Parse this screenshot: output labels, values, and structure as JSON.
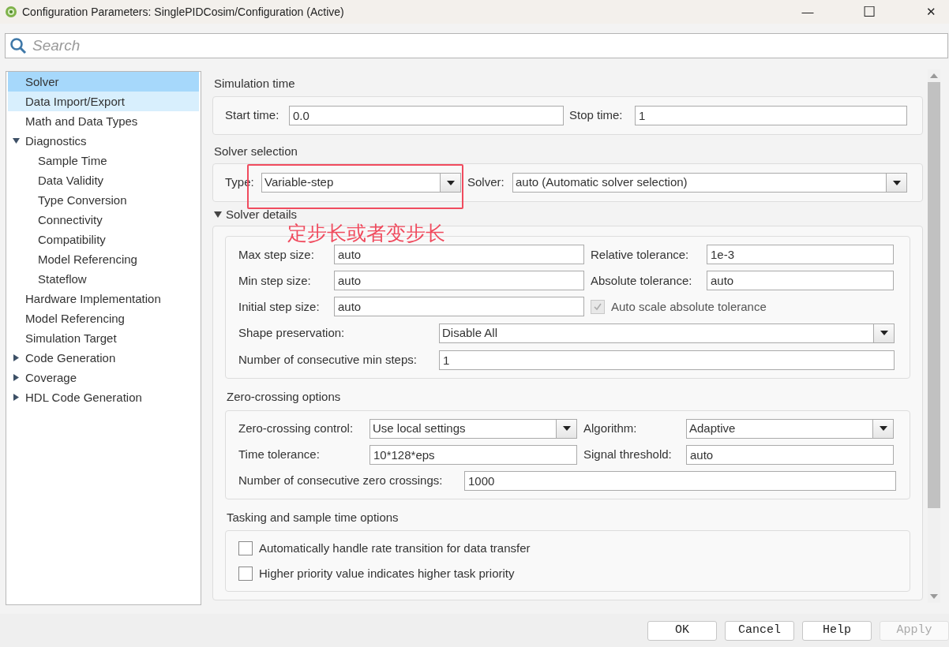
{
  "window": {
    "title": "Configuration Parameters: SinglePIDCosim/Configuration (Active)",
    "controls": [
      "—",
      "☐",
      "✕"
    ]
  },
  "search": {
    "placeholder": "Search"
  },
  "sidebar": {
    "items": [
      {
        "label": "Solver",
        "selected": true,
        "hovered": false
      },
      {
        "label": "Data Import/Export",
        "selected": false,
        "hovered": true
      },
      {
        "label": "Math and Data Types",
        "selected": false,
        "hovered": false
      },
      {
        "label": "Diagnostics",
        "selected": false,
        "hovered": false,
        "expanded": true,
        "children": [
          {
            "label": "Sample Time",
            "selected": false,
            "hovered": false
          },
          {
            "label": "Data Validity",
            "selected": false,
            "hovered": false
          },
          {
            "label": "Type Conversion",
            "selected": false,
            "hovered": false
          },
          {
            "label": "Connectivity",
            "selected": false,
            "hovered": false
          },
          {
            "label": "Compatibility",
            "selected": false,
            "hovered": false
          },
          {
            "label": "Model Referencing",
            "selected": false,
            "hovered": false
          },
          {
            "label": "Stateflow",
            "selected": false,
            "hovered": false
          }
        ]
      },
      {
        "label": "Hardware Implementation",
        "selected": false,
        "hovered": false
      },
      {
        "label": "Model Referencing",
        "selected": false,
        "hovered": false
      },
      {
        "label": "Simulation Target",
        "selected": false,
        "hovered": false
      },
      {
        "label": "Code Generation",
        "selected": false,
        "hovered": false,
        "expanded": false
      },
      {
        "label": "Coverage",
        "selected": false,
        "hovered": false,
        "expanded": false
      },
      {
        "label": "HDL Code Generation",
        "selected": false,
        "hovered": false,
        "expanded": false
      }
    ]
  },
  "sections": [
    {
      "title": "Simulation time",
      "rows": [
        [
          {
            "kind": "text",
            "label": "Start time:",
            "value": "0.0"
          },
          {
            "kind": "text",
            "label": "Stop time:",
            "value": "1"
          }
        ]
      ]
    },
    {
      "title": "Solver selection",
      "rows": [
        [
          {
            "kind": "select",
            "label": "Type:",
            "value": "Variable-step"
          },
          {
            "kind": "select",
            "label": "Solver:",
            "value": "auto (Automatic solver selection)"
          }
        ]
      ]
    }
  ],
  "solver_details": {
    "title": "Solver details",
    "expanded": true,
    "groups": [
      {
        "rows": [
          [
            {
              "kind": "text",
              "label": "Max step size:",
              "value": "auto"
            },
            {
              "kind": "text",
              "label": "Relative tolerance:",
              "value": "1e-3"
            }
          ],
          [
            {
              "kind": "text",
              "label": "Min step size:",
              "value": "auto"
            },
            {
              "kind": "text",
              "label": "Absolute tolerance:",
              "value": "auto"
            }
          ],
          [
            {
              "kind": "text",
              "label": "Initial step size:",
              "value": "auto"
            },
            {
              "kind": "checkbox",
              "label": "Auto scale absolute tolerance",
              "checked": true,
              "disabled": true
            }
          ],
          [
            {
              "kind": "select",
              "label": "Shape preservation:",
              "value": "Disable All"
            }
          ],
          [
            {
              "kind": "text",
              "label": "Number of consecutive min steps:",
              "value": "1"
            }
          ]
        ]
      },
      {
        "title": "Zero-crossing options",
        "rows": [
          [
            {
              "kind": "select",
              "label": "Zero-crossing control:",
              "value": "Use local settings"
            },
            {
              "kind": "select",
              "label": "Algorithm:",
              "value": "Adaptive"
            }
          ],
          [
            {
              "kind": "text",
              "label": "Time tolerance:",
              "value": "10*128*eps"
            },
            {
              "kind": "text",
              "label": "Signal threshold:",
              "value": "auto"
            }
          ],
          [
            {
              "kind": "text",
              "label": "Number of consecutive zero crossings:",
              "value": "1000"
            }
          ]
        ]
      },
      {
        "title": "Tasking and sample time options",
        "rows": [
          [
            {
              "kind": "checkbox",
              "label": "Automatically handle rate transition for data transfer",
              "checked": false,
              "disabled": false
            }
          ],
          [
            {
              "kind": "checkbox",
              "label": "Higher priority value indicates higher task priority",
              "checked": false,
              "disabled": false
            }
          ]
        ]
      }
    ]
  },
  "annotation": {
    "text": "定步长或者变步长"
  },
  "buttons": [
    {
      "label": "OK",
      "disabled": false
    },
    {
      "label": "Cancel",
      "disabled": false
    },
    {
      "label": "Help",
      "disabled": false
    },
    {
      "label": "Apply",
      "disabled": true
    }
  ]
}
